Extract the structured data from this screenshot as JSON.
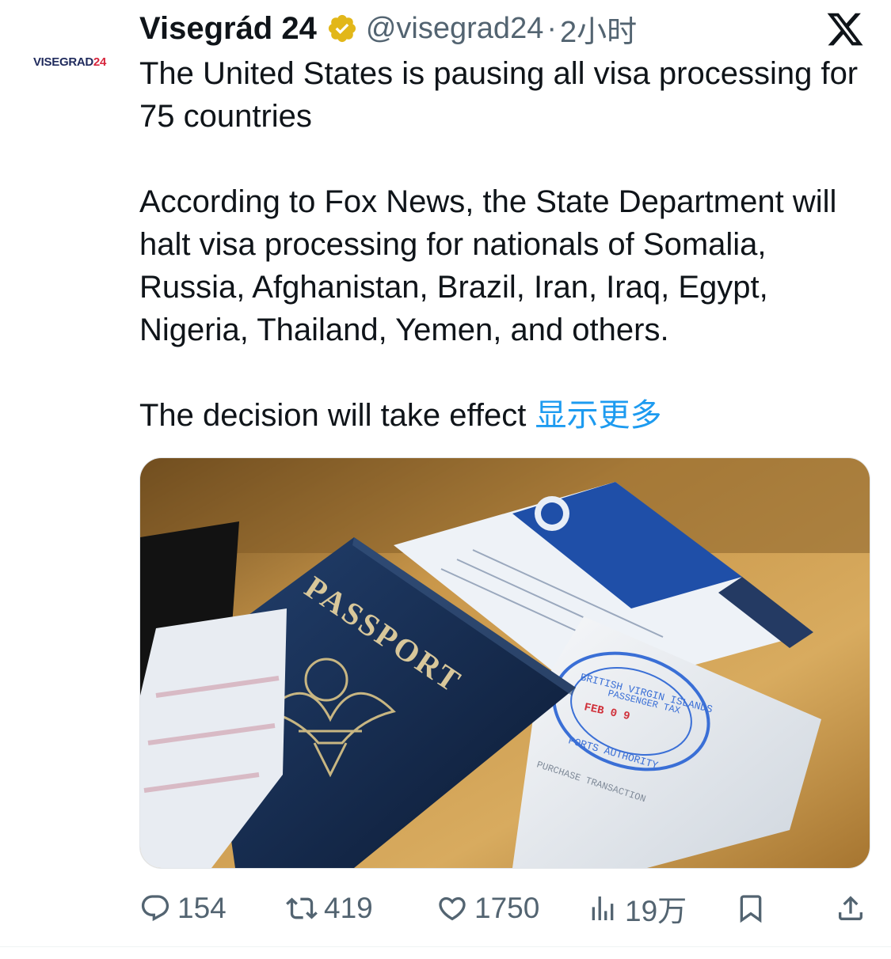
{
  "tweet": {
    "avatar_text_main": "VISEGRAD",
    "avatar_text_accent": "24",
    "display_name": "Visegrád 24",
    "handle": "@visegrad24",
    "separator": "·",
    "time": "2小时",
    "paragraph_1": "The United States is pausing all visa processing for 75 countries",
    "paragraph_2": "According to Fox News, the State Department will halt visa processing for nationals of Somalia, Russia, Afghanistan, Brazil, Iran, Iraq, Egypt, Nigeria, Thailand, Yemen, and others.",
    "paragraph_3": "The decision will take effect ",
    "show_more": "显示更多"
  },
  "media": {
    "passport_label": "PASSPORT",
    "stamp_line_1": "BRITISH VIRGIN ISLANDS",
    "stamp_line_2": "PASSENGER TAX",
    "stamp_line_3": "PORTS AUTHORITY",
    "stamp_date": "FEB 0 9",
    "receipt_line": "PURCHASE TRANSACTION"
  },
  "actions": {
    "replies": "154",
    "retweets": "419",
    "likes": "1750",
    "views": "19万"
  },
  "icons": {
    "verified": "verified-badge-icon",
    "logo": "x-logo-icon",
    "reply": "reply-icon",
    "retweet": "retweet-icon",
    "like": "heart-icon",
    "views": "views-chart-icon",
    "bookmark": "bookmark-icon",
    "share": "share-icon"
  },
  "colors": {
    "link": "#1d9bf0",
    "text": "#0f1419",
    "muted": "#536471",
    "verified_gold": "#e2b719",
    "passport_navy": "#14294b"
  }
}
